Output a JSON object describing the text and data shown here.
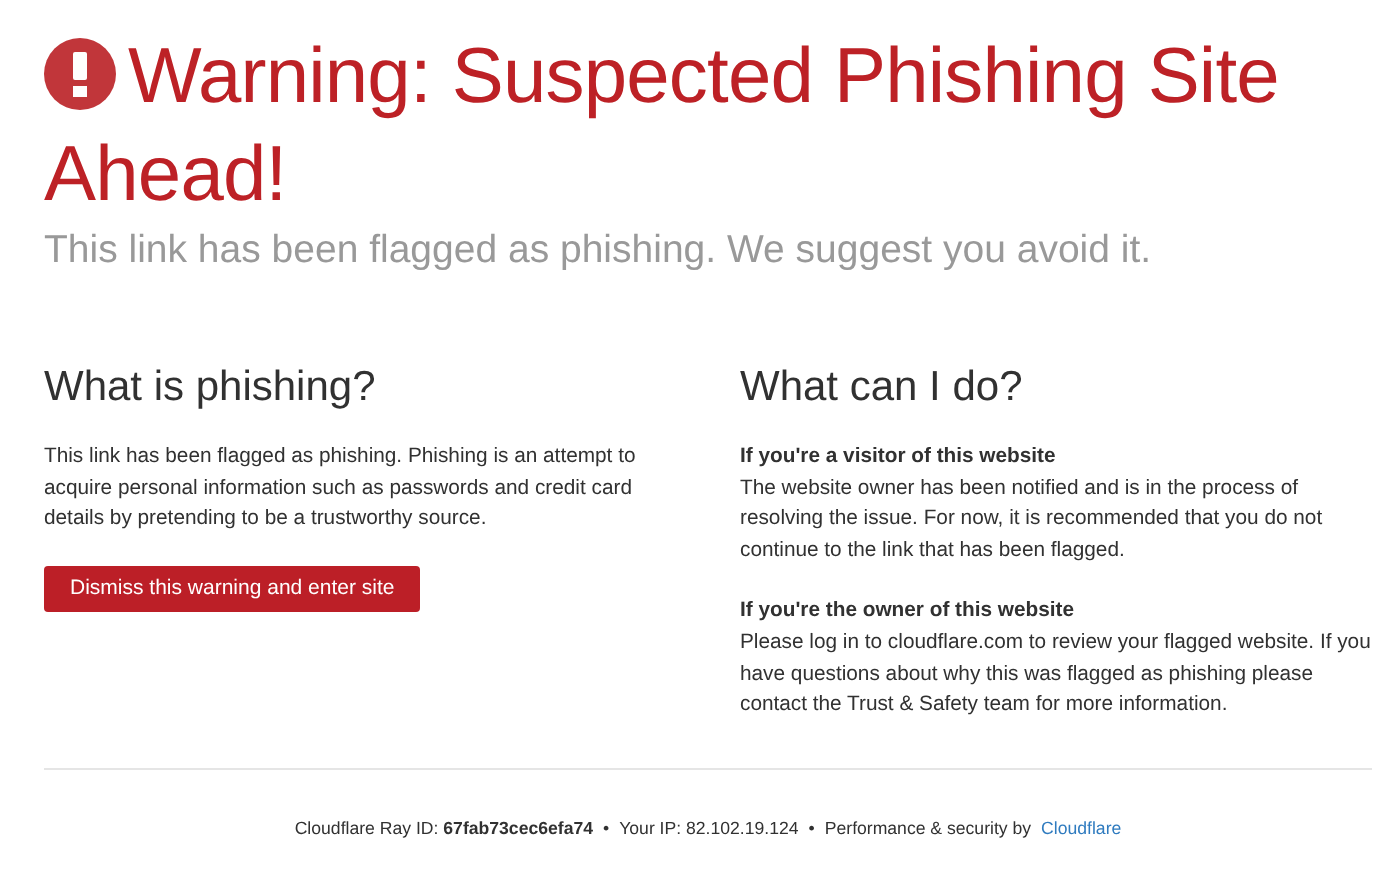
{
  "header": {
    "title": "Warning: Suspected Phishing Site Ahead!",
    "subtitle": "This link has been flagged as phishing. We suggest you avoid it."
  },
  "left": {
    "heading": "What is phishing?",
    "paragraph": "This link has been flagged as phishing. Phishing is an attempt to acquire personal information such as passwords and credit card details by pretending to be a trustworthy source.",
    "button": "Dismiss this warning and enter site"
  },
  "right": {
    "heading": "What can I do?",
    "sections": [
      {
        "title": "If you're a visitor of this website",
        "text": "The website owner has been notified and is in the process of resolving the issue. For now, it is recommended that you do not continue to the link that has been flagged."
      },
      {
        "title": "If you're the owner of this website",
        "text": "Please log in to cloudflare.com to review your flagged website. If you have questions about why this was flagged as phishing please contact the Trust & Safety team for more information."
      }
    ]
  },
  "footer": {
    "items": [
      {
        "kind": "text",
        "text": "Cloudflare Ray ID: **67fab73cec6efa74**"
      },
      {
        "kind": "text",
        "text": "Your IP: 82.102.19.124"
      },
      {
        "kind": "link",
        "text": "Performance & security by",
        "link": "Cloudflare"
      }
    ],
    "separator": "•"
  }
}
